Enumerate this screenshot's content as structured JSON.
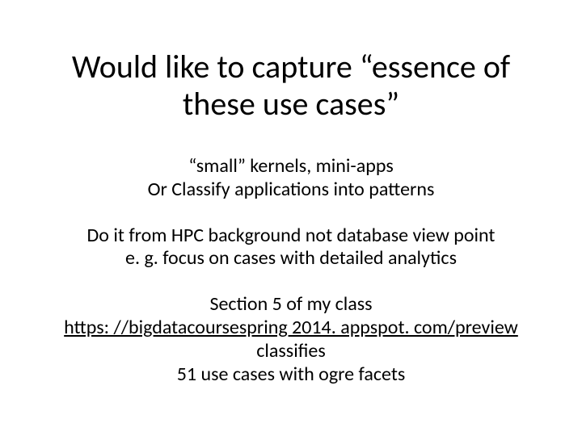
{
  "title": "Would like to capture “essence of these use cases”",
  "block1_line1": "“small” kernels, mini-apps",
  "block1_line2": "Or Classify applications into patterns",
  "block2_line1": "Do it from HPC background not database view point",
  "block2_line2": "e. g. focus on cases with detailed analytics",
  "block3_line1": "Section 5 of my class",
  "block3_link": "https: //bigdatacoursespring 2014. appspot. com/preview",
  "block3_after_link": " classifies",
  "block3_line3": "51 use cases with ogre facets"
}
